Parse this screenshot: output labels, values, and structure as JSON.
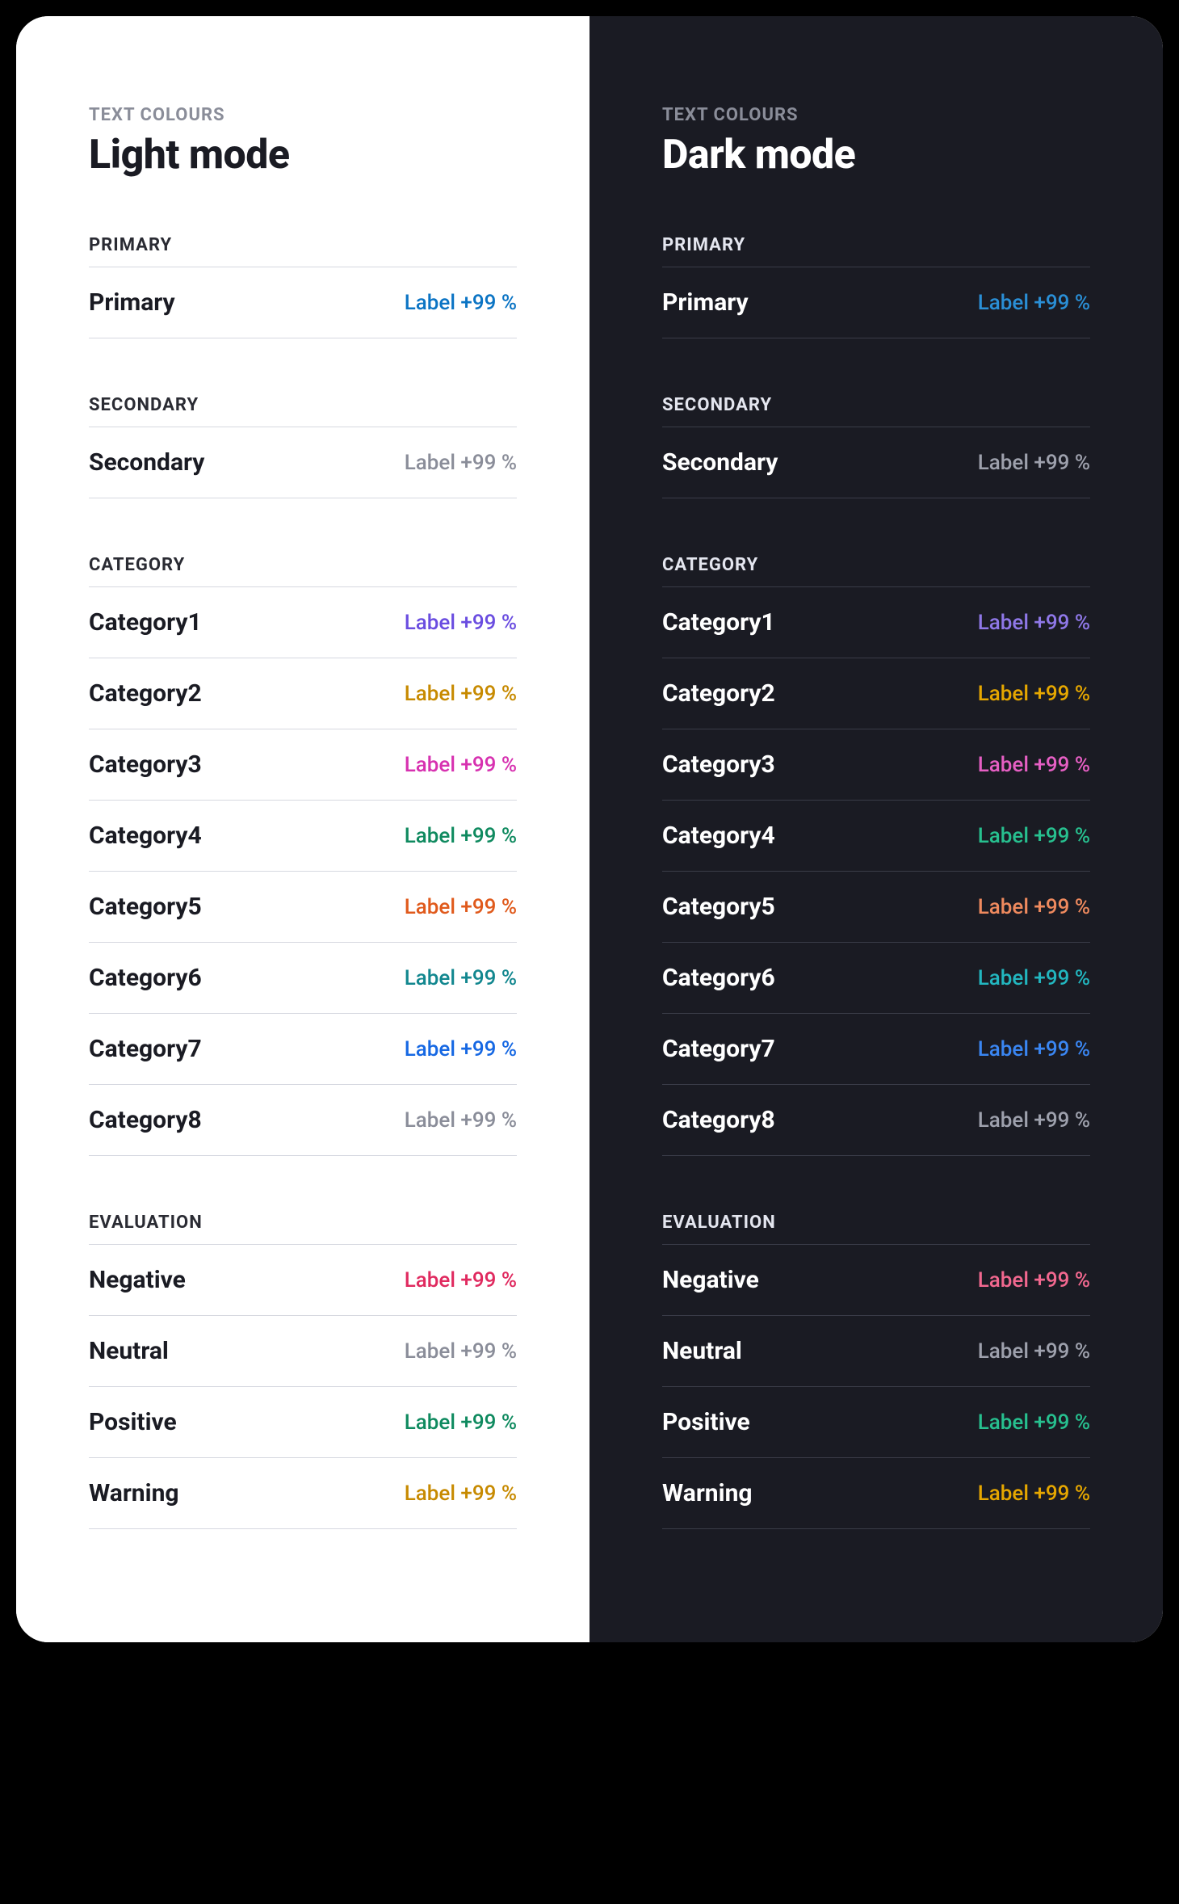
{
  "eyebrow": "TEXT COLOURS",
  "light_title": "Light mode",
  "dark_title": "Dark mode",
  "label_text": "Label +99 %",
  "sections": [
    {
      "key": "primary",
      "title": "PRIMARY",
      "rows": [
        {
          "name": "Primary",
          "light": "#0b74c4",
          "dark": "#2a8fd6"
        }
      ]
    },
    {
      "key": "secondary",
      "title": "SECONDARY",
      "rows": [
        {
          "name": "Secondary",
          "light": "#8a8d99",
          "dark": "#9ea1ad"
        }
      ]
    },
    {
      "key": "category",
      "title": "CATEGORY",
      "rows": [
        {
          "name": "Category1",
          "light": "#6a4de0",
          "dark": "#8f78e8"
        },
        {
          "name": "Category2",
          "light": "#c78a00",
          "dark": "#e6a700"
        },
        {
          "name": "Category3",
          "light": "#d731b0",
          "dark": "#e65fc4"
        },
        {
          "name": "Category4",
          "light": "#0f8a5f",
          "dark": "#27c08f"
        },
        {
          "name": "Category5",
          "light": "#e05a1c",
          "dark": "#ef8a5e"
        },
        {
          "name": "Category6",
          "light": "#12878f",
          "dark": "#22b6bf"
        },
        {
          "name": "Category7",
          "light": "#1668e3",
          "dark": "#3a86f2"
        },
        {
          "name": "Category8",
          "light": "#8a8d99",
          "dark": "#9ea1ad"
        }
      ]
    },
    {
      "key": "evaluation",
      "title": "EVALUATION",
      "rows": [
        {
          "name": "Negative",
          "light": "#e02a5f",
          "dark": "#f2688f"
        },
        {
          "name": "Neutral",
          "light": "#8a8d99",
          "dark": "#9ea1ad"
        },
        {
          "name": "Positive",
          "light": "#0f8a5f",
          "dark": "#27c08f"
        },
        {
          "name": "Warning",
          "light": "#c78a00",
          "dark": "#e6a700"
        }
      ]
    }
  ]
}
